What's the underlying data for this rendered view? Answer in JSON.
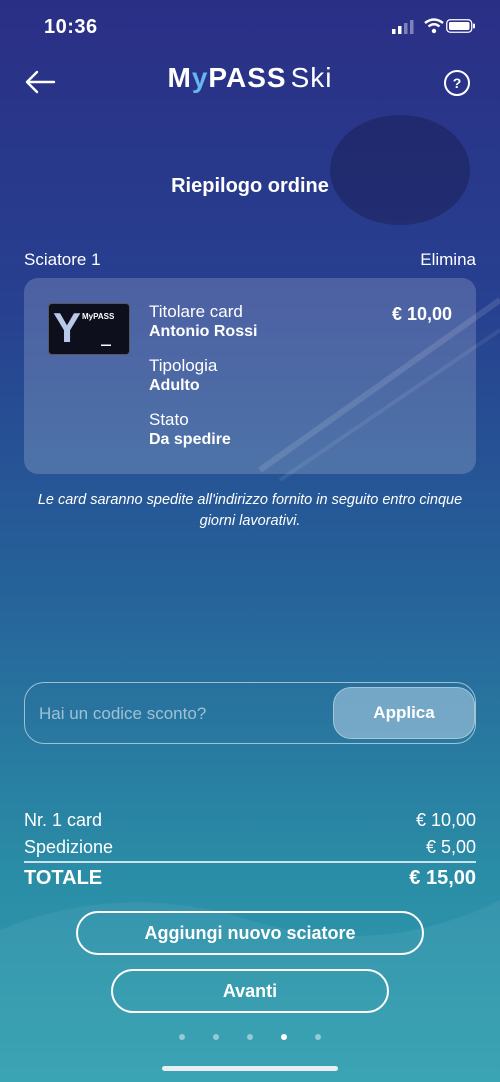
{
  "status_bar": {
    "time": "10:36"
  },
  "header": {
    "logo_brand": "MyPASS",
    "logo_suffix": "Ski",
    "help_symbol": "?"
  },
  "title": "Riepilogo ordine",
  "skier": {
    "label": "Sciatore 1",
    "delete_label": "Elimina",
    "card": {
      "image_brand": "MyPASS",
      "fields": [
        {
          "key": "Titolare card",
          "value": "Antonio Rossi"
        },
        {
          "key": "Tipologia",
          "value": "Adulto"
        },
        {
          "key": "Stato",
          "value": "Da spedire"
        }
      ],
      "price": "€ 10,00"
    }
  },
  "note": "Le card saranno spedite all'indirizzo fornito in seguito entro cinque giorni lavorativi.",
  "discount": {
    "placeholder": "Hai un codice sconto?",
    "apply_label": "Applica"
  },
  "summary": {
    "rows": [
      {
        "label": "Nr. 1 card",
        "value": "€ 10,00"
      },
      {
        "label": "Spedizione",
        "value": "€ 5,00"
      }
    ],
    "total_label": "TOTALE",
    "total_value": "€ 15,00"
  },
  "buttons": {
    "add_skier": "Aggiungi nuovo sciatore",
    "next": "Avanti"
  },
  "pagination": {
    "count": 5,
    "active_index": 3
  },
  "colors": {
    "accent": "#67b6ef",
    "bg_top": "#2a2f86",
    "bg_bottom": "#2e9fb0"
  }
}
